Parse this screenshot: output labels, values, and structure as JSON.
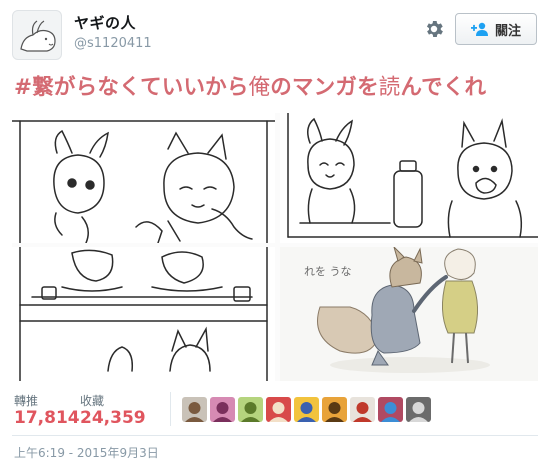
{
  "user": {
    "display_name": "ヤギの人",
    "handle": "@s1120411"
  },
  "header": {
    "follow_label": "關注"
  },
  "tweet": {
    "hashtag": "#繋",
    "text_a": "がらなくていいから",
    "text_b": "俺",
    "text_c": "のマンガを",
    "text_d": "読",
    "text_e": "んでくれ"
  },
  "media": {
    "panel4_caption": "れを うな"
  },
  "stats": {
    "retweets_label": "轉推",
    "retweets_value": "17,814",
    "likes_label": "收藏",
    "likes_value": "24,359"
  },
  "faces": [
    {
      "name": "face-1",
      "bg": "#c9c2b8",
      "fg": "#7a5a3f"
    },
    {
      "name": "face-2",
      "bg": "#d68ab3",
      "fg": "#7a2f5c"
    },
    {
      "name": "face-3",
      "bg": "#b5d47e",
      "fg": "#5b7a2a"
    },
    {
      "name": "face-4",
      "bg": "#d84a4a",
      "fg": "#f3e0c8"
    },
    {
      "name": "face-5",
      "bg": "#f2c33d",
      "fg": "#3a61b0"
    },
    {
      "name": "face-6",
      "bg": "#e8a33a",
      "fg": "#5a3a14"
    },
    {
      "name": "face-7",
      "bg": "#e8e3dc",
      "fg": "#c0392b"
    },
    {
      "name": "face-8",
      "bg": "#b04a62",
      "fg": "#3c8ed6"
    },
    {
      "name": "face-9",
      "bg": "#6b6b6b",
      "fg": "#d8d8d8"
    }
  ],
  "meta": {
    "timestamp": "上午6:19 - 2015年9月3日"
  },
  "colors": {
    "accent_red": "#e0555e",
    "tweet_text": "#d46a72",
    "muted": "#8899a6"
  }
}
